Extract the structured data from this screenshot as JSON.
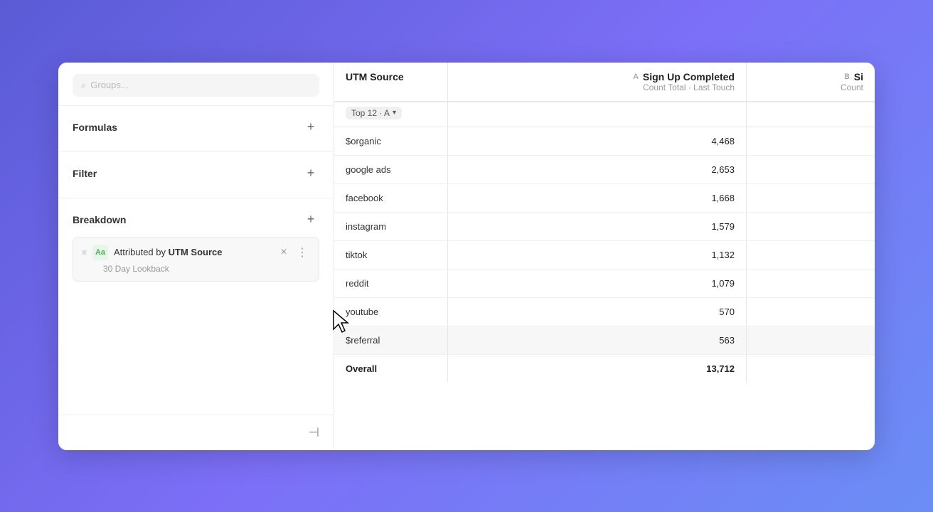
{
  "sidebar": {
    "formulas_label": "Formulas",
    "filter_label": "Filter",
    "breakdown_label": "Breakdown",
    "breakdown_card": {
      "attributed_by": "Attributed by",
      "utm_source": "UTM Source",
      "lookback": "30 Day Lookback"
    },
    "collapse_icon": "⊣"
  },
  "table": {
    "col_utm_label": "UTM Source",
    "col_utm_filter": "Top 12 · A",
    "col_a_letter": "A",
    "col_a_event": "Sign Up Completed",
    "col_a_sub": "Count Total · Last Touch",
    "col_b_letter": "B",
    "col_b_event": "Si",
    "col_b_sub": "Count",
    "rows": [
      {
        "utm": "$organic",
        "value_a": "4,468",
        "value_b": ""
      },
      {
        "utm": "google ads",
        "value_a": "2,653",
        "value_b": ""
      },
      {
        "utm": "facebook",
        "value_a": "1,668",
        "value_b": ""
      },
      {
        "utm": "instagram",
        "value_a": "1,579",
        "value_b": ""
      },
      {
        "utm": "tiktok",
        "value_a": "1,132",
        "value_b": ""
      },
      {
        "utm": "reddit",
        "value_a": "1,079",
        "value_b": ""
      },
      {
        "utm": "youtube",
        "value_a": "570",
        "value_b": ""
      },
      {
        "utm": "$referral",
        "value_a": "563",
        "value_b": "",
        "highlighted": true
      },
      {
        "utm": "Overall",
        "value_a": "13,712",
        "value_b": "",
        "overall": true
      }
    ]
  }
}
